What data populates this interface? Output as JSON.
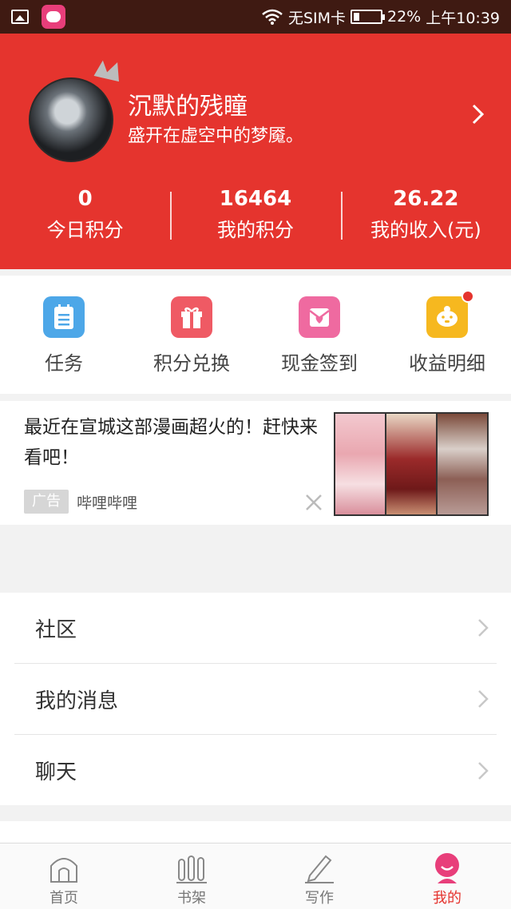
{
  "status_bar": {
    "carrier": "无SIM卡",
    "battery_percent_text": "22%",
    "battery_level": 0.22,
    "time": "上午10:39"
  },
  "profile": {
    "name": "沉默的残瞳",
    "motto": "盛开在虚空中的梦魇。"
  },
  "stats": [
    {
      "value": "0",
      "label": "今日积分"
    },
    {
      "value": "16464",
      "label": "我的积分"
    },
    {
      "value": "26.22",
      "label": "我的收入(元)"
    }
  ],
  "actions": [
    {
      "label": "任务",
      "icon": "task-list-icon",
      "color": "#4da7e8"
    },
    {
      "label": "积分兑换",
      "icon": "gift-icon",
      "color": "#ef5a64"
    },
    {
      "label": "现金签到",
      "icon": "envelope-heart-icon",
      "color": "#ef6aa0"
    },
    {
      "label": "收益明细",
      "icon": "piggy-bank-icon",
      "color": "#f6b81f"
    }
  ],
  "ad": {
    "text": "最近在宣城这部漫画超火的！赶快来看吧！",
    "tag": "广告",
    "source": "哔哩哔哩"
  },
  "menu": [
    {
      "label": "社区"
    },
    {
      "label": "我的消息"
    },
    {
      "label": "聊天"
    }
  ],
  "bottom_nav": [
    {
      "label": "首页",
      "icon": "home-icon"
    },
    {
      "label": "书架",
      "icon": "bookshelf-icon"
    },
    {
      "label": "写作",
      "icon": "pencil-icon"
    },
    {
      "label": "我的",
      "icon": "profile-icon",
      "active": true
    }
  ],
  "colors": {
    "brand_red": "#e5342e",
    "status_bar": "#3f1a12"
  }
}
